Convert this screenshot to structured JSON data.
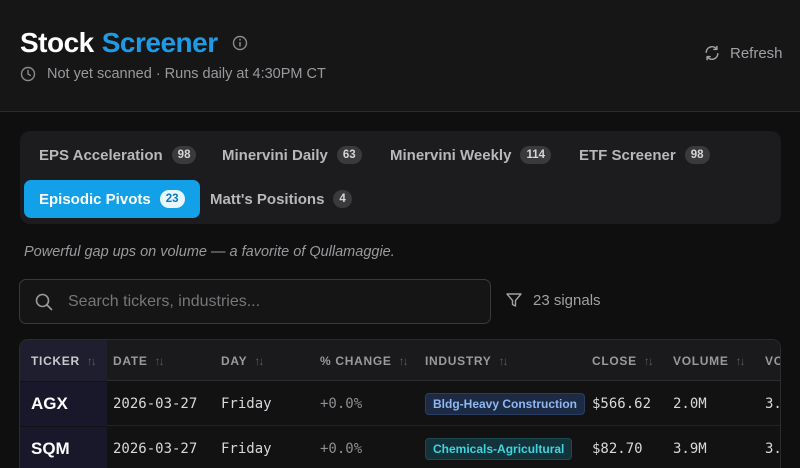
{
  "header": {
    "title_part1": "Stock",
    "title_part2": "Screener",
    "status": "Not yet scanned · Runs daily at 4:30PM CT",
    "refresh_label": "Refresh"
  },
  "tabs": [
    {
      "label": "EPS Acceleration",
      "count": "98",
      "active": false
    },
    {
      "label": "Minervini Daily",
      "count": "63",
      "active": false
    },
    {
      "label": "Minervini Weekly",
      "count": "114",
      "active": false
    },
    {
      "label": "ETF Screener",
      "count": "98",
      "active": false
    },
    {
      "label": "Episodic Pivots",
      "count": "23",
      "active": true
    },
    {
      "label": "Matt's Positions",
      "count": "4",
      "active": false
    }
  ],
  "description": "Powerful gap ups on volume — a favorite of Qullamaggie.",
  "search": {
    "placeholder": "Search tickers, industries...",
    "value": ""
  },
  "signals_label": "23 signals",
  "table": {
    "columns": [
      "TICKER",
      "DATE",
      "DAY",
      "% CHANGE",
      "INDUSTRY",
      "CLOSE",
      "VOLUME",
      "VO"
    ],
    "rows": [
      {
        "ticker": "AGX",
        "date": "2026-03-27",
        "day": "Friday",
        "change": "+0.0%",
        "industry": "Bldg-Heavy Construction",
        "close": "$566.62",
        "volume": "2.0M",
        "vo": "3."
      },
      {
        "ticker": "SQM",
        "date": "2026-03-27",
        "day": "Friday",
        "change": "+0.0%",
        "industry": "Chemicals-Agricultural",
        "close": "$82.70",
        "volume": "3.9M",
        "vo": "3."
      }
    ]
  },
  "colors": {
    "accent": "#1e9be6",
    "active_tab": "#12a0e8",
    "background": "#0f0f10"
  },
  "icons": [
    "info-icon",
    "clock-icon",
    "refresh-icon",
    "search-icon",
    "filter-icon",
    "sort-icon"
  ]
}
